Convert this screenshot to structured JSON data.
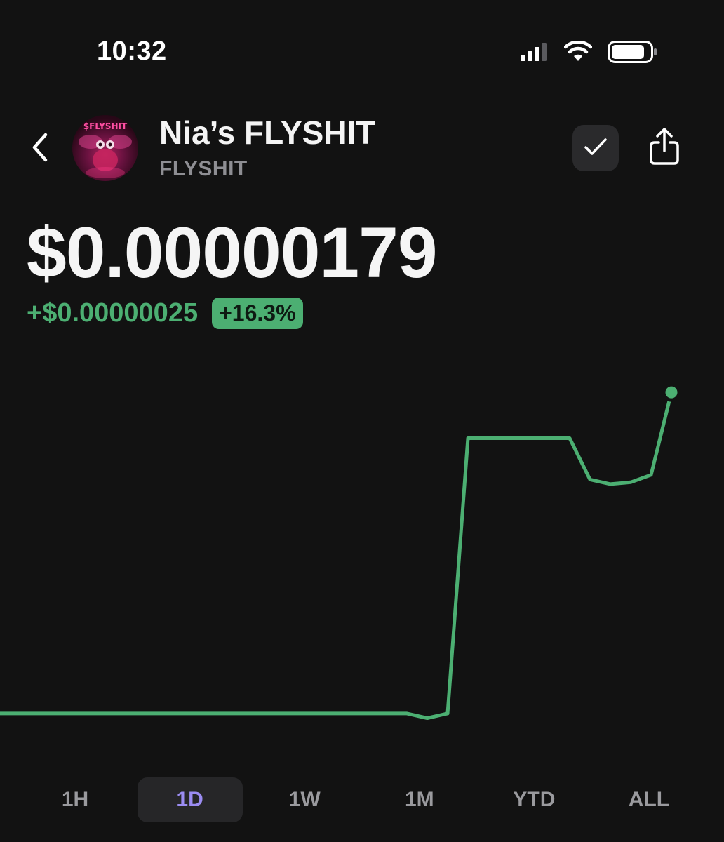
{
  "status_bar": {
    "time": "10:32",
    "icons": [
      "cellular-signal-icon",
      "wifi-icon",
      "battery-icon"
    ]
  },
  "header": {
    "back_icon": "chevron-left-icon",
    "avatar_text": "$FLYSHIT",
    "token_name": "Nia’s FLYSHIT",
    "token_symbol": "FLYSHIT",
    "watchlist_icon": "checkmark-icon",
    "share_icon": "share-icon"
  },
  "price": {
    "value": "$0.00000179",
    "change_abs": "+$0.00000025",
    "change_pct": "+16.3%"
  },
  "colors": {
    "background": "#121212",
    "positive": "#4caf72",
    "active_tab": "#9b8cf2"
  },
  "chart_data": {
    "type": "line",
    "series": [
      {
        "values": [
          1.54,
          1.54,
          1.54,
          1.54,
          1.54,
          1.54,
          1.54,
          1.54,
          1.54,
          1.54,
          1.54,
          1.54,
          1.54,
          1.54,
          1.54,
          1.54,
          1.54,
          1.54,
          1.54,
          1.54,
          1.54,
          1.535,
          1.54,
          1.84,
          1.84,
          1.84,
          1.84,
          1.84,
          1.84,
          1.795,
          1.79,
          1.792,
          1.8,
          1.89
        ]
      }
    ],
    "ylim": [
      1.53,
      1.9
    ],
    "grid": false,
    "legend": "none"
  },
  "range_tabs": [
    {
      "label": "1H",
      "active": false
    },
    {
      "label": "1D",
      "active": true
    },
    {
      "label": "1W",
      "active": false
    },
    {
      "label": "1M",
      "active": false
    },
    {
      "label": "YTD",
      "active": false
    },
    {
      "label": "ALL",
      "active": false
    }
  ]
}
